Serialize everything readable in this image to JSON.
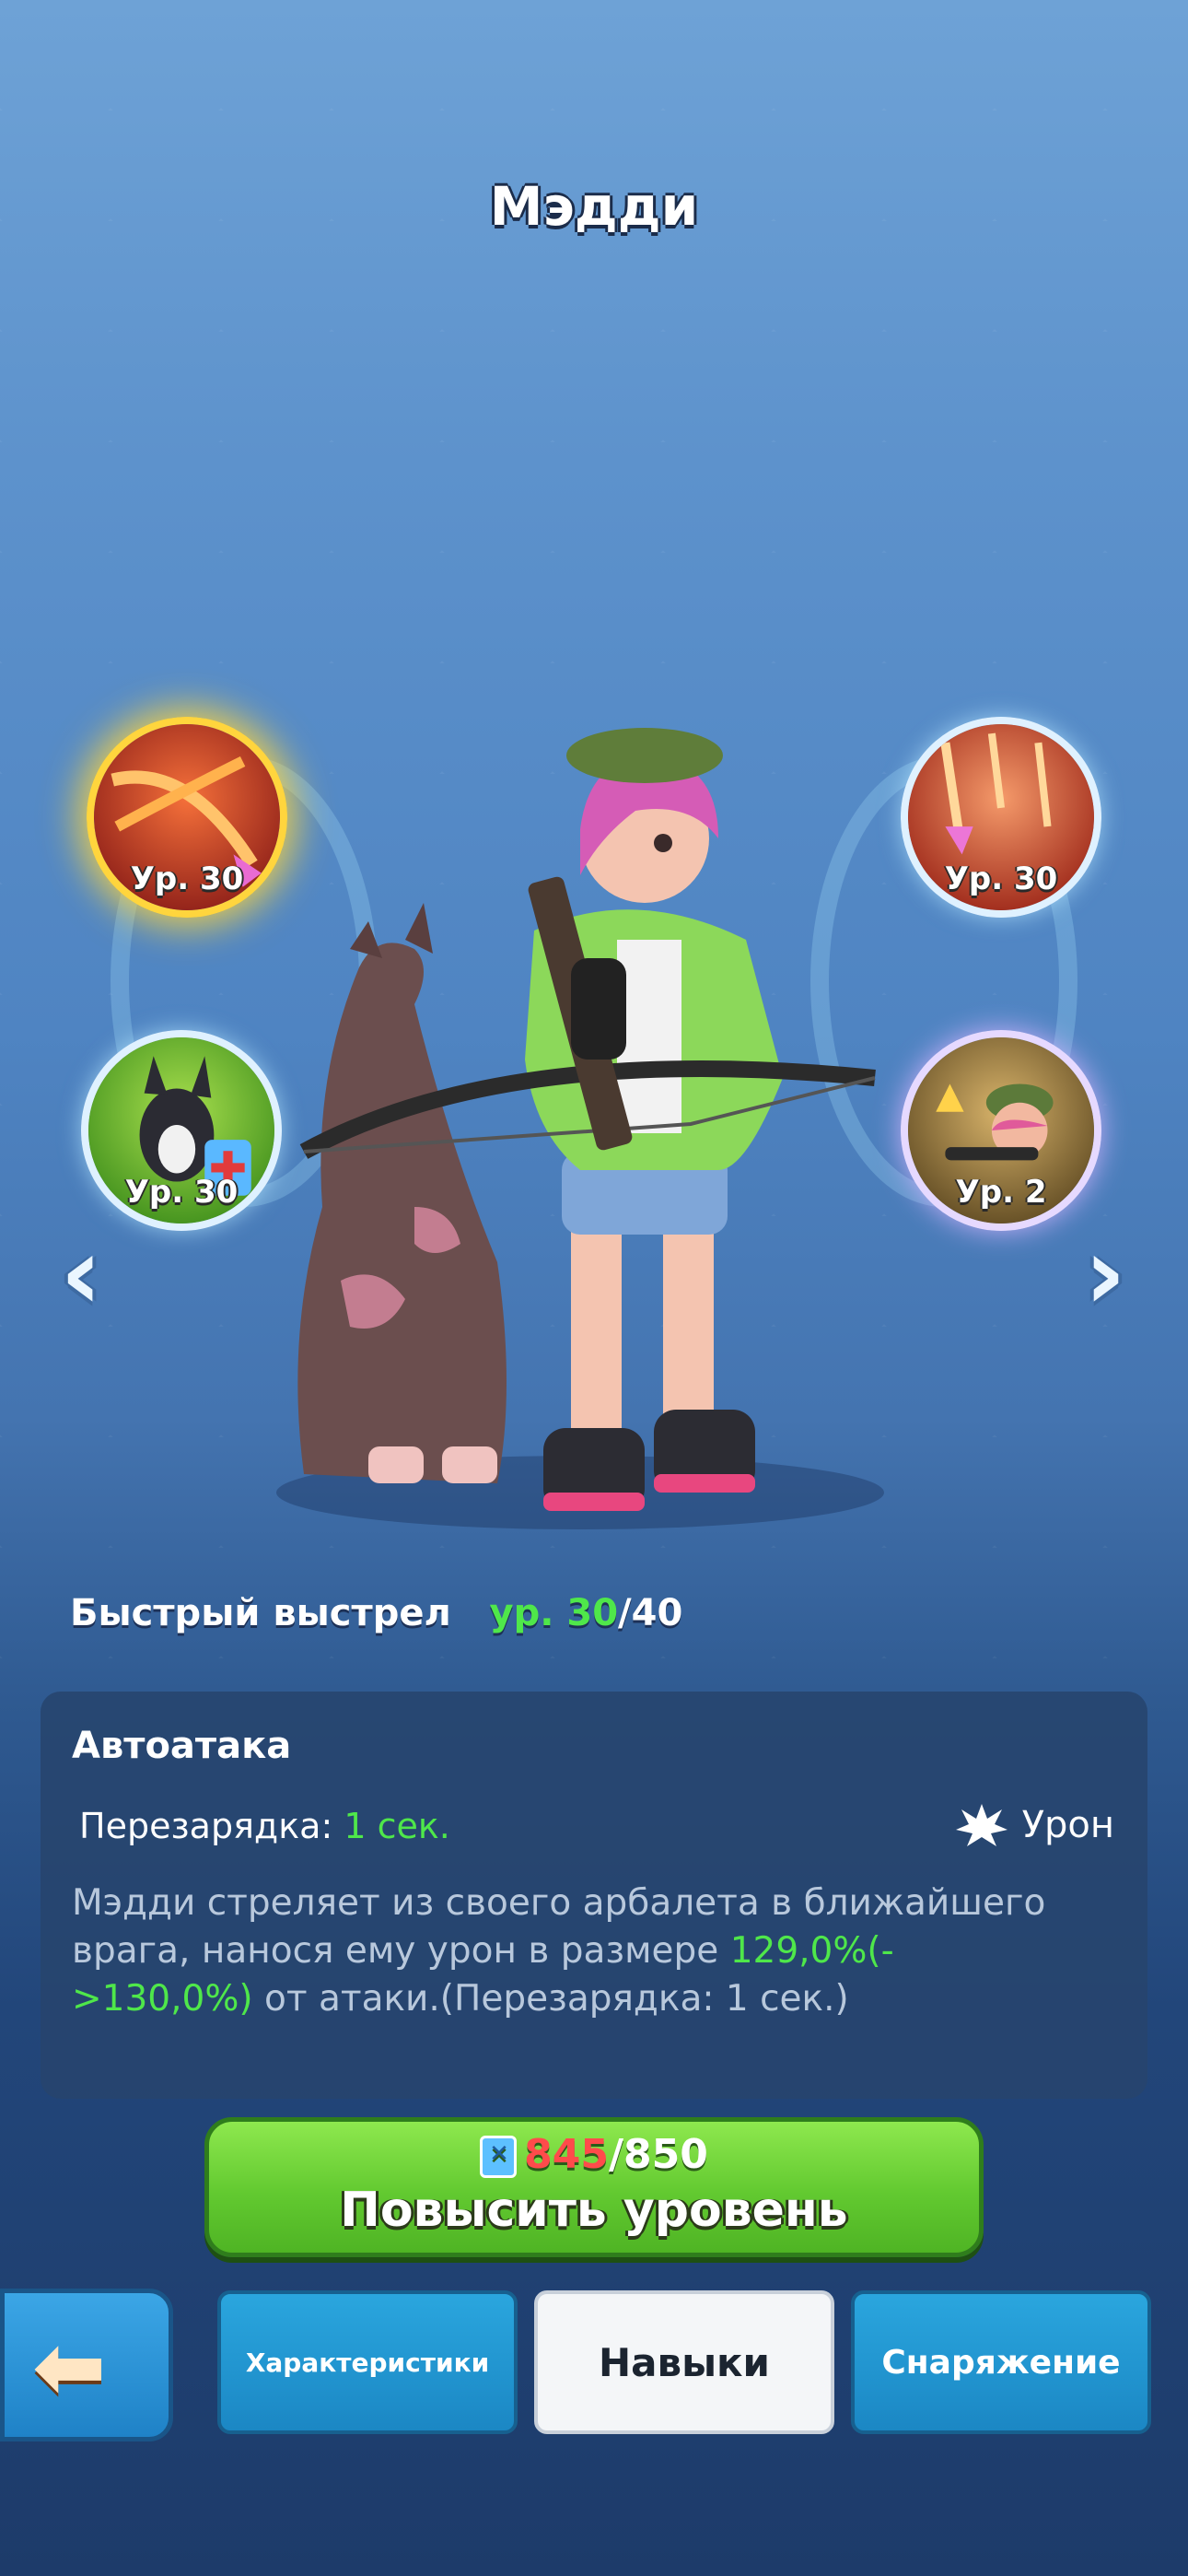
{
  "hero": {
    "name": "Мэдди"
  },
  "skills": [
    {
      "id": "fast-shot",
      "level": "Ур. 30",
      "selected": true,
      "icon": "crossed-arrows-icon"
    },
    {
      "id": "dog",
      "level": "Ур. 30",
      "selected": false,
      "icon": "dog-companion-icon"
    },
    {
      "id": "arrow-rain",
      "level": "Ур. 30",
      "selected": false,
      "icon": "arrows-rain-icon"
    },
    {
      "id": "sniper",
      "level": "Ур. 2",
      "selected": false,
      "icon": "sniper-portrait-icon"
    }
  ],
  "nav": {
    "prev": "‹",
    "next": "›"
  },
  "skill_info": {
    "name": "Быстрый выстрел",
    "level_prefix": "ур. ",
    "level_current": "30",
    "level_max": "/40"
  },
  "panel": {
    "title": "Автоатака",
    "cooldown_label": "Перезарядка: ",
    "cooldown_value": "1 сек.",
    "damage_label": "Урон",
    "desc_part1": "Мэдди стреляет из своего арбалета в ближайшего врага, нанося ему урон в размере ",
    "desc_highlight": "129,0%(->130,0%)",
    "desc_part2": " от атаки.(Перезарядка: 1 сек.)"
  },
  "upgrade": {
    "have": "845",
    "need": "/850",
    "label": "Повысить уровень"
  },
  "tabs": {
    "stats": "Характеристики",
    "skills": "Навыки",
    "equipment": "Снаряжение"
  },
  "colors": {
    "accent_green": "#4fe74a",
    "gold_selected": "#ffd53d",
    "cost_red": "#ff4b4b"
  }
}
